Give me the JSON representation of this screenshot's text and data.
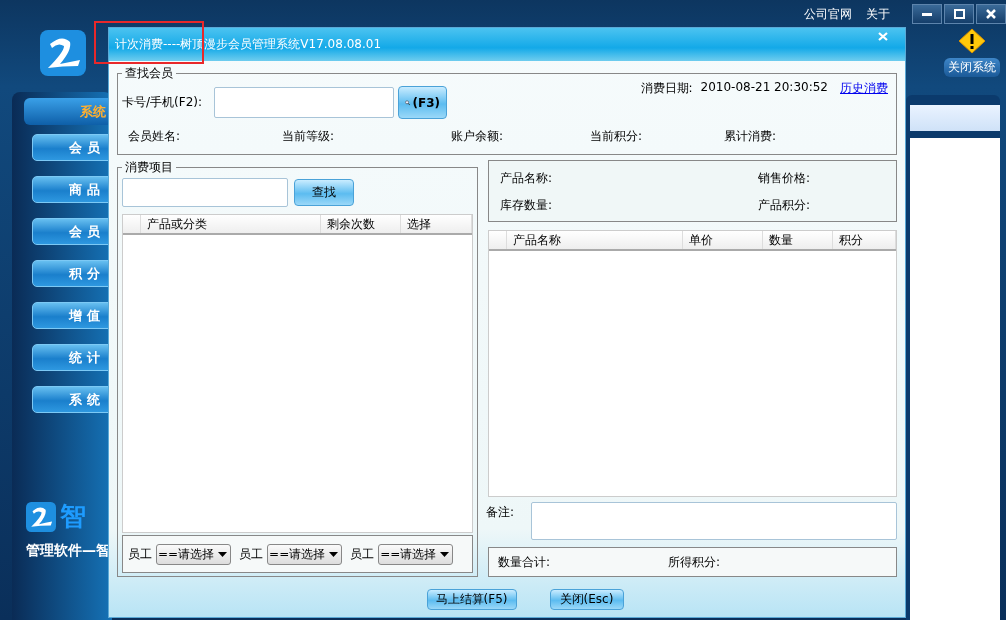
{
  "app": {
    "top_links": [
      "公司官网",
      "关于"
    ],
    "toolbar": [
      {
        "label": "关闭系统"
      }
    ],
    "sidebar": {
      "header": "系统",
      "items": [
        "会 员",
        "商 品",
        "会 员",
        "积 分",
        "增 值",
        "统 计",
        "系 统"
      ]
    },
    "brand": {
      "logo_text": "智",
      "tagline": "管理软件—智"
    }
  },
  "dialog": {
    "title": "计次消费----树顶漫步会员管理系统V17.08.08.01",
    "member_search": {
      "legend": "查找会员",
      "card_label": "卡号/手机(F2):",
      "search_button": "(F3)",
      "date_label": "消费日期:",
      "date_value": "2010-08-21 20:30:52",
      "history_link": "历史消费",
      "info_labels": [
        "会员姓名:",
        "当前等级:",
        "账户余额:",
        "当前积分:",
        "累计消费:"
      ]
    },
    "items": {
      "legend": "消费项目",
      "search_button": "查找",
      "columns": [
        "产品或分类",
        "剩余次数",
        "选择"
      ],
      "staff": [
        {
          "label": "员工",
          "value": "==请选择"
        },
        {
          "label": "员工",
          "value": "==请选择"
        },
        {
          "label": "员工",
          "value": "==请选择"
        }
      ]
    },
    "product": {
      "fields": [
        "产品名称:",
        "销售价格:",
        "库存数量:",
        "产品积分:"
      ]
    },
    "cart": {
      "columns": [
        "产品名称",
        "单价",
        "数量",
        "积分"
      ]
    },
    "note_label": "备注:",
    "totals": [
      "数量合计:",
      "所得积分:"
    ],
    "buttons": [
      "马上结算(F5)",
      "关闭(Esc)"
    ]
  }
}
